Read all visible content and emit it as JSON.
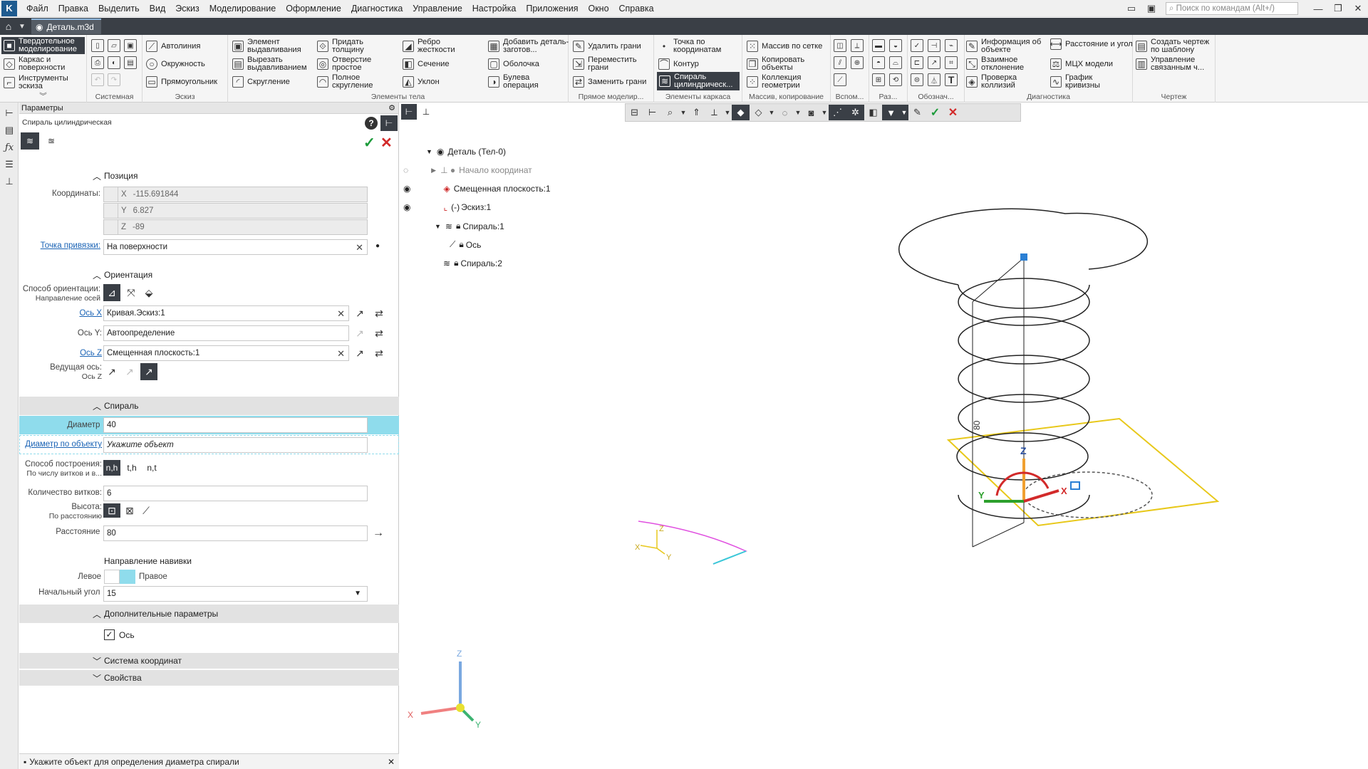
{
  "menu": [
    "Файл",
    "Правка",
    "Выделить",
    "Вид",
    "Эскиз",
    "Моделирование",
    "Оформление",
    "Диагностика",
    "Управление",
    "Настройка",
    "Приложения",
    "Окно",
    "Справка"
  ],
  "search": {
    "placeholder": "Поиск по командам (Alt+/)"
  },
  "doc_tab": "Деталь.m3d",
  "ribbon": {
    "modes": [
      "Твердотельное моделирование",
      "Каркас и поверхности",
      "Инструменты эскиза"
    ],
    "groups": [
      "Системная",
      "Эскиз",
      "Элементы тела",
      "Прямое моделир...",
      "Элементы каркаса",
      "Массив, копирование",
      "Вспом...",
      "Раз...",
      "Обознач...",
      "Диагностика",
      "Чертеж"
    ],
    "sketch": [
      "Автолиния",
      "Окружность",
      "Прямоугольник"
    ],
    "body1": [
      "Элемент выдавливания",
      "Вырезать выдавливанием",
      "Скругление"
    ],
    "body2": [
      "Придать толщину",
      "Отверстие простое",
      "Полное скругление"
    ],
    "body3": [
      "Ребро жесткости",
      "Сечение",
      "Уклон"
    ],
    "body4": [
      "Добавить деталь-заготов...",
      "Оболочка",
      "Булева операция"
    ],
    "direct": [
      "Удалить грани",
      "Переместить грани",
      "Заменить грани"
    ],
    "frame": [
      "Точка по координатам",
      "Контур",
      "Спираль цилиндрическ..."
    ],
    "array": [
      "Массив по сетке",
      "Копировать объекты",
      "Коллекция геометрии"
    ],
    "diag1": [
      "Информация об объекте",
      "Взаимное отклонение",
      "Проверка коллизий"
    ],
    "diag2": [
      "Расстояние и угол",
      "МЦХ модели",
      "График кривизны"
    ],
    "drawing": [
      "Создать чертеж по шаблону",
      "Управление связанным ч..."
    ]
  },
  "panel": {
    "header": "Параметры",
    "title": "Спираль цилиндрическая",
    "sec_position": "Позиция",
    "coords_label": "Координаты:",
    "x_axis": "X",
    "x_val": "-115.691844",
    "y_axis": "Y",
    "y_val": "6.827",
    "z_axis": "Z",
    "z_val": "-89",
    "snap_label": "Точка привязки:",
    "snap_val": "На поверхности",
    "sec_orient": "Ориентация",
    "orient_label": "Способ ориентации:",
    "orient_sub": "Направление осей",
    "axisx_label": "Ось X",
    "axisx_val": "Кривая.Эскиз:1",
    "axisy_label": "Ось Y:",
    "axisy_val": "Автоопределение",
    "axisz_label": "Ось Z",
    "axisz_val": "Смещенная плоскость:1",
    "lead_label": "Ведущая ось:",
    "lead_sub": "Ось Z",
    "sec_spiral": "Спираль",
    "diam_label": "Диаметр",
    "diam_val": "40",
    "diamobj_label": "Диаметр по объекту",
    "diamobj_val": "Укажите объект",
    "build_label": "Способ построения:",
    "build_sub": "По числу витков и в...",
    "build_opts": [
      "n,h",
      "t,h",
      "n,t"
    ],
    "turns_label": "Количество витков:",
    "turns_val": "6",
    "height_label": "Высота:",
    "height_sub": "По расстоянию",
    "dist_label": "Расстояние",
    "dist_val": "80",
    "wind_title": "Направление навивки",
    "left_label": "Левое",
    "right_label": "Правое",
    "angle_label": "Начальный угол",
    "angle_val": "15",
    "sec_extra": "Дополнительные параметры",
    "axis_check": "Ось",
    "sec_cs": "Система координат",
    "sec_props": "Свойства"
  },
  "tree": {
    "root": "Деталь (Тел-0)",
    "origin": "Начало координат",
    "plane": "Смещенная плоскость:1",
    "sketch": "Эскиз:1",
    "spiral1": "Спираль:1",
    "axis": "Ось",
    "spiral2": "Спираль:2"
  },
  "viewport": {
    "dim_label": "80",
    "triad_x": "X",
    "triad_y": "Y",
    "triad_z": "Z",
    "sk_x": "X",
    "sk_y": "Y",
    "sk_z": "Z",
    "axis_x": "X",
    "axis_y": "Y",
    "axis_z": "Z"
  },
  "status": "Укажите объект для определения диаметра спирали",
  "colors": {
    "accent": "#8fdcec",
    "link": "#1a63b5",
    "plane": "#e8c81a",
    "ok": "#1c9b3a",
    "cancel": "#d22a2a"
  }
}
